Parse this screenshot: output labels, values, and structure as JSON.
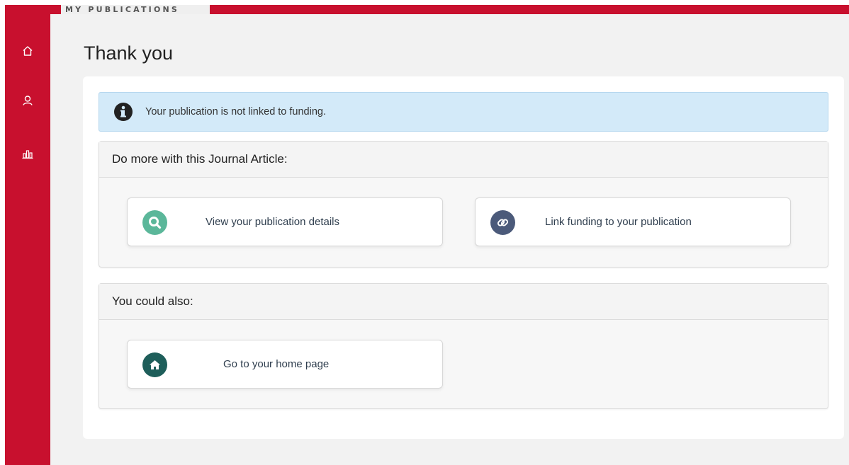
{
  "brand": {
    "name": "MY PUBLICATIONS"
  },
  "sidebar": {
    "items": [
      {
        "icon": "home-icon"
      },
      {
        "icon": "user-icon"
      },
      {
        "icon": "bar-chart-icon"
      }
    ]
  },
  "page": {
    "title": "Thank you"
  },
  "alert": {
    "icon": "info-icon",
    "text": "Your publication is not linked to funding."
  },
  "panels": [
    {
      "title": "Do more with this Journal Article:",
      "actions": [
        {
          "label": "View your publication details",
          "icon": "search-icon",
          "color": "#5bb79a"
        },
        {
          "label": "Link funding to your publication",
          "icon": "link-icon",
          "color": "#4b5a7a"
        }
      ]
    },
    {
      "title": "You could also:",
      "actions": [
        {
          "label": "Go to your home page",
          "icon": "home-icon",
          "color": "#1e5e5a"
        }
      ]
    }
  ],
  "colors": {
    "brand": "#c8102e",
    "alert_bg": "#d3eaf9",
    "page_bg": "#f2f2f2"
  }
}
